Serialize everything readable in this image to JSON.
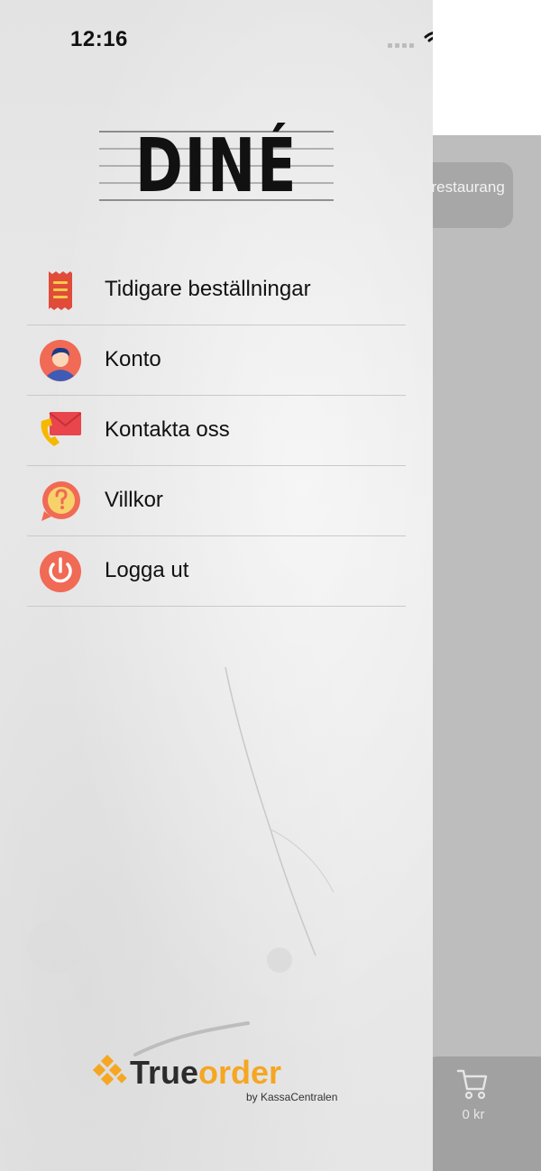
{
  "status_bar": {
    "time": "12:16"
  },
  "background": {
    "change_restaurant_label": "Byt restaurang",
    "cart_total": "0 kr"
  },
  "drawer": {
    "logo_text": "DINÉ",
    "menu": [
      {
        "label": "Tidigare beställningar",
        "icon": "receipt-icon"
      },
      {
        "label": "Konto",
        "icon": "account-avatar-icon"
      },
      {
        "label": "Kontakta oss",
        "icon": "contact-mail-phone-icon"
      },
      {
        "label": "Villkor",
        "icon": "terms-question-icon"
      },
      {
        "label": "Logga ut",
        "icon": "power-icon"
      }
    ],
    "brand": {
      "word_true": "True",
      "word_order": "order",
      "by_line": "by KassaCentralen"
    }
  },
  "colors": {
    "brand_orange": "#f5a623",
    "receipt_red": "#e04b3a",
    "power_red": "#f06a55",
    "terms_yellow": "#f7c948",
    "battery_green": "#30d158"
  }
}
